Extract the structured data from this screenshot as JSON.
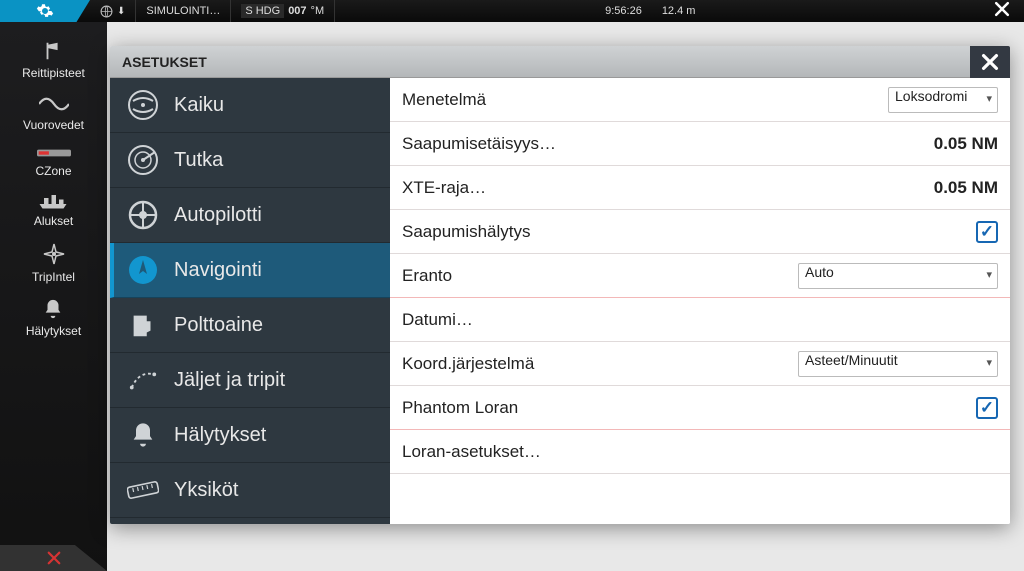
{
  "topbar": {
    "globe_icon": "globe",
    "sim_label": "SIMULOINTI…",
    "hdg_prefix": "S HDG",
    "hdg_value": "007",
    "hdg_unit": "°M",
    "time": "9:56:26",
    "depth": "12.4 m"
  },
  "leftbar": {
    "items": [
      {
        "name": "reittipisteet",
        "label": "Reittipisteet",
        "icon": "flag"
      },
      {
        "name": "vuorovedet",
        "label": "Vuorovedet",
        "icon": "wave"
      },
      {
        "name": "czone",
        "label": "CZone",
        "icon": "czone"
      },
      {
        "name": "alukset",
        "label": "Alukset",
        "icon": "ship"
      },
      {
        "name": "tripintel",
        "label": "TripIntel",
        "icon": "compass"
      },
      {
        "name": "halytykset",
        "label": "Hälytykset",
        "icon": "bell"
      }
    ]
  },
  "dialog": {
    "title": "ASETUKSET",
    "categories": [
      {
        "name": "kaiku",
        "label": "Kaiku",
        "icon": "sonar"
      },
      {
        "name": "tutka",
        "label": "Tutka",
        "icon": "radar"
      },
      {
        "name": "autopilotti",
        "label": "Autopilotti",
        "icon": "wheel"
      },
      {
        "name": "navigointi",
        "label": "Navigointi",
        "icon": "nav",
        "selected": true
      },
      {
        "name": "polttoaine",
        "label": "Polttoaine",
        "icon": "fuel"
      },
      {
        "name": "jaljet",
        "label": "Jäljet ja tripit",
        "icon": "tracks"
      },
      {
        "name": "halytykset2",
        "label": "Hälytykset",
        "icon": "bell2"
      },
      {
        "name": "yksikot",
        "label": "Yksiköt",
        "icon": "ruler"
      }
    ],
    "rows": {
      "method_label": "Menetelmä",
      "method_value": "Loksodromi",
      "arrival_dist_label": "Saapumisetäisyys…",
      "arrival_dist_value": "0.05 NM",
      "xte_label": "XTE-raja…",
      "xte_value": "0.05 NM",
      "arrival_alarm_label": "Saapumishälytys",
      "arrival_alarm_checked": true,
      "eranto_label": "Eranto",
      "eranto_value": "Auto",
      "datum_label": "Datumi…",
      "coord_label": "Koord.järjestelmä",
      "coord_value": "Asteet/Minuutit",
      "phantom_label": "Phantom Loran",
      "phantom_checked": true,
      "loran_label": "Loran-asetukset…"
    }
  }
}
